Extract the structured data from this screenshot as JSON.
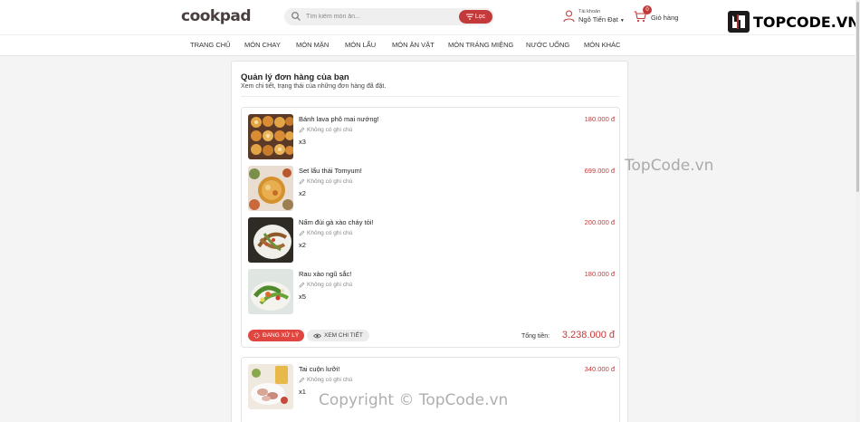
{
  "header": {
    "logo": "cookpad",
    "search_placeholder": "Tìm kiếm món ăn...",
    "filter_label": "Lọc",
    "account_label": "Tài khoản",
    "account_name": "Ngô Tiến Đạt",
    "cart_count": "0",
    "cart_label": "Giỏ hàng"
  },
  "brand": {
    "text": "TOPCODE.VN"
  },
  "nav": {
    "items": [
      "TRANG CHỦ",
      "MÓN CHAY",
      "MÓN MẶN",
      "MÓN LẨU",
      "MÓN ĂN VẶT",
      "MÓN TRÁNG MIỆNG",
      "NƯỚC UỐNG",
      "MÓN KHÁC"
    ]
  },
  "page": {
    "title": "Quản lý đơn hàng của bạn",
    "subtitle": "Xem chi tiết, trạng thái của những đơn hàng đã đặt."
  },
  "orders": [
    {
      "items": [
        {
          "name": "Bánh lava phô mai nướng!",
          "note": "Không có ghi chú",
          "qty": "x3",
          "price": "180.000 đ",
          "image": "cheese-lava-cakes"
        },
        {
          "name": "Set lẩu thái Tomyum!",
          "note": "Không có ghi chú",
          "qty": "x2",
          "price": "699.000 đ",
          "image": "tomyum-hotpot"
        },
        {
          "name": "Nấm đùi gà xào cháy tỏi!",
          "note": "Không có ghi chú",
          "qty": "x2",
          "price": "200.000 đ",
          "image": "garlic-mushroom"
        },
        {
          "name": "Rau xào ngũ sắc!",
          "note": "Không có ghi chú",
          "qty": "x5",
          "price": "180.000 đ",
          "image": "stir-fried-vegetables"
        }
      ],
      "status": "ĐANG XỬ LÝ",
      "detail_label": "XEM CHI TIẾT",
      "total_label": "Tổng tiền:",
      "total": "3.238.000 đ"
    },
    {
      "items": [
        {
          "name": "Tai cuộn lưỡi!",
          "note": "Không có ghi chú",
          "qty": "x1",
          "price": "340.000 đ",
          "image": "ear-tongue-roll"
        }
      ]
    }
  ],
  "watermarks": {
    "mid": "TopCode.vn",
    "bottom": "Copyright © TopCode.vn"
  },
  "colors": {
    "accent": "#c43a3a",
    "status": "#e0463f"
  }
}
